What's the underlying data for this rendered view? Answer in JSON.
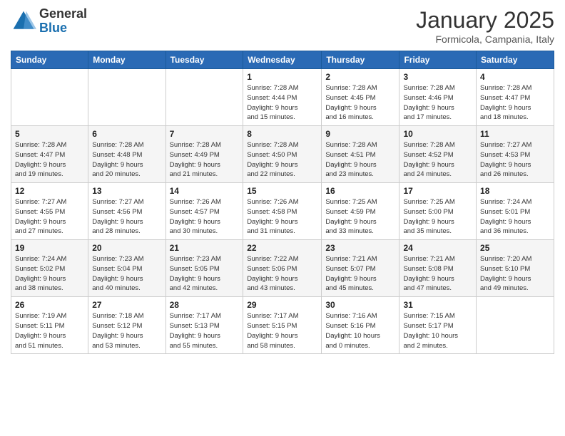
{
  "header": {
    "logo_general": "General",
    "logo_blue": "Blue",
    "month": "January 2025",
    "location": "Formicola, Campania, Italy"
  },
  "days_of_week": [
    "Sunday",
    "Monday",
    "Tuesday",
    "Wednesday",
    "Thursday",
    "Friday",
    "Saturday"
  ],
  "weeks": [
    [
      {
        "day": "",
        "info": ""
      },
      {
        "day": "",
        "info": ""
      },
      {
        "day": "",
        "info": ""
      },
      {
        "day": "1",
        "info": "Sunrise: 7:28 AM\nSunset: 4:44 PM\nDaylight: 9 hours\nand 15 minutes."
      },
      {
        "day": "2",
        "info": "Sunrise: 7:28 AM\nSunset: 4:45 PM\nDaylight: 9 hours\nand 16 minutes."
      },
      {
        "day": "3",
        "info": "Sunrise: 7:28 AM\nSunset: 4:46 PM\nDaylight: 9 hours\nand 17 minutes."
      },
      {
        "day": "4",
        "info": "Sunrise: 7:28 AM\nSunset: 4:47 PM\nDaylight: 9 hours\nand 18 minutes."
      }
    ],
    [
      {
        "day": "5",
        "info": "Sunrise: 7:28 AM\nSunset: 4:47 PM\nDaylight: 9 hours\nand 19 minutes."
      },
      {
        "day": "6",
        "info": "Sunrise: 7:28 AM\nSunset: 4:48 PM\nDaylight: 9 hours\nand 20 minutes."
      },
      {
        "day": "7",
        "info": "Sunrise: 7:28 AM\nSunset: 4:49 PM\nDaylight: 9 hours\nand 21 minutes."
      },
      {
        "day": "8",
        "info": "Sunrise: 7:28 AM\nSunset: 4:50 PM\nDaylight: 9 hours\nand 22 minutes."
      },
      {
        "day": "9",
        "info": "Sunrise: 7:28 AM\nSunset: 4:51 PM\nDaylight: 9 hours\nand 23 minutes."
      },
      {
        "day": "10",
        "info": "Sunrise: 7:28 AM\nSunset: 4:52 PM\nDaylight: 9 hours\nand 24 minutes."
      },
      {
        "day": "11",
        "info": "Sunrise: 7:27 AM\nSunset: 4:53 PM\nDaylight: 9 hours\nand 26 minutes."
      }
    ],
    [
      {
        "day": "12",
        "info": "Sunrise: 7:27 AM\nSunset: 4:55 PM\nDaylight: 9 hours\nand 27 minutes."
      },
      {
        "day": "13",
        "info": "Sunrise: 7:27 AM\nSunset: 4:56 PM\nDaylight: 9 hours\nand 28 minutes."
      },
      {
        "day": "14",
        "info": "Sunrise: 7:26 AM\nSunset: 4:57 PM\nDaylight: 9 hours\nand 30 minutes."
      },
      {
        "day": "15",
        "info": "Sunrise: 7:26 AM\nSunset: 4:58 PM\nDaylight: 9 hours\nand 31 minutes."
      },
      {
        "day": "16",
        "info": "Sunrise: 7:25 AM\nSunset: 4:59 PM\nDaylight: 9 hours\nand 33 minutes."
      },
      {
        "day": "17",
        "info": "Sunrise: 7:25 AM\nSunset: 5:00 PM\nDaylight: 9 hours\nand 35 minutes."
      },
      {
        "day": "18",
        "info": "Sunrise: 7:24 AM\nSunset: 5:01 PM\nDaylight: 9 hours\nand 36 minutes."
      }
    ],
    [
      {
        "day": "19",
        "info": "Sunrise: 7:24 AM\nSunset: 5:02 PM\nDaylight: 9 hours\nand 38 minutes."
      },
      {
        "day": "20",
        "info": "Sunrise: 7:23 AM\nSunset: 5:04 PM\nDaylight: 9 hours\nand 40 minutes."
      },
      {
        "day": "21",
        "info": "Sunrise: 7:23 AM\nSunset: 5:05 PM\nDaylight: 9 hours\nand 42 minutes."
      },
      {
        "day": "22",
        "info": "Sunrise: 7:22 AM\nSunset: 5:06 PM\nDaylight: 9 hours\nand 43 minutes."
      },
      {
        "day": "23",
        "info": "Sunrise: 7:21 AM\nSunset: 5:07 PM\nDaylight: 9 hours\nand 45 minutes."
      },
      {
        "day": "24",
        "info": "Sunrise: 7:21 AM\nSunset: 5:08 PM\nDaylight: 9 hours\nand 47 minutes."
      },
      {
        "day": "25",
        "info": "Sunrise: 7:20 AM\nSunset: 5:10 PM\nDaylight: 9 hours\nand 49 minutes."
      }
    ],
    [
      {
        "day": "26",
        "info": "Sunrise: 7:19 AM\nSunset: 5:11 PM\nDaylight: 9 hours\nand 51 minutes."
      },
      {
        "day": "27",
        "info": "Sunrise: 7:18 AM\nSunset: 5:12 PM\nDaylight: 9 hours\nand 53 minutes."
      },
      {
        "day": "28",
        "info": "Sunrise: 7:17 AM\nSunset: 5:13 PM\nDaylight: 9 hours\nand 55 minutes."
      },
      {
        "day": "29",
        "info": "Sunrise: 7:17 AM\nSunset: 5:15 PM\nDaylight: 9 hours\nand 58 minutes."
      },
      {
        "day": "30",
        "info": "Sunrise: 7:16 AM\nSunset: 5:16 PM\nDaylight: 10 hours\nand 0 minutes."
      },
      {
        "day": "31",
        "info": "Sunrise: 7:15 AM\nSunset: 5:17 PM\nDaylight: 10 hours\nand 2 minutes."
      },
      {
        "day": "",
        "info": ""
      }
    ]
  ]
}
